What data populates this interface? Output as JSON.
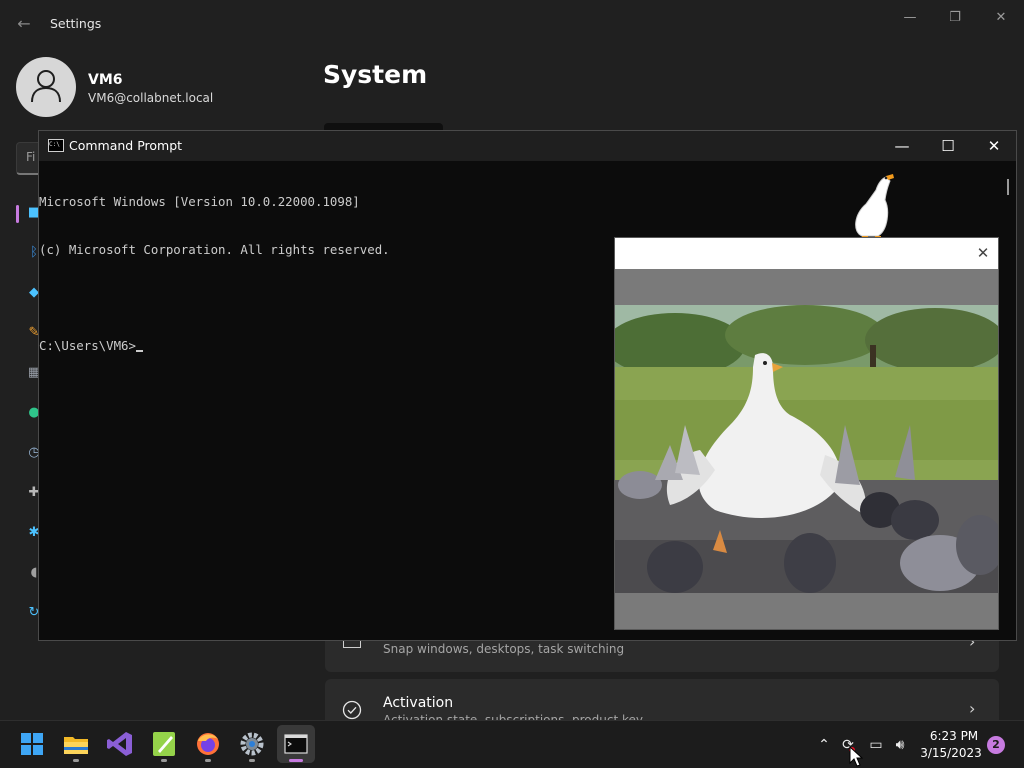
{
  "settings": {
    "title": "Settings",
    "page_title": "System",
    "user": {
      "name": "VM6",
      "email": "VM6@collabnet.local"
    },
    "search_placeholder": "Fi",
    "cards": [
      {
        "title": "",
        "subtitle": "Snap windows, desktops, task switching"
      },
      {
        "title": "Activation",
        "subtitle": "Activation state, subscriptions, product key"
      }
    ],
    "nav_icons": [
      "system-icon",
      "bluetooth-icon",
      "network-icon",
      "personalization-icon",
      "apps-icon",
      "accounts-icon",
      "time-language-icon",
      "gaming-icon",
      "accessibility-icon",
      "privacy-security-icon",
      "windows-update-icon"
    ]
  },
  "cmd": {
    "title": "Command Prompt",
    "icon_text": "C:\\",
    "lines": [
      "Microsoft Windows [Version 10.0.22000.1098]",
      "(c) Microsoft Corporation. All rights reserved.",
      "",
      "C:\\Users\\VM6>"
    ]
  },
  "popup": {
    "close_label": "✕",
    "image_description_icon": "goose-with-pigeons-photo"
  },
  "taskbar": {
    "apps": [
      "start-icon",
      "file-explorer-icon",
      "visual-studio-icon",
      "notepad-plus-icon",
      "firefox-icon",
      "settings-icon",
      "command-prompt-icon"
    ],
    "active_app": "command-prompt-icon",
    "clock": {
      "time": "6:23 PM",
      "date": "3/15/2023"
    },
    "notification_count": "2"
  },
  "colors": {
    "accent": "#c77be0",
    "settings_bg": "#202020",
    "console_bg": "#0c0c0c",
    "console_text": "#cccccc"
  }
}
